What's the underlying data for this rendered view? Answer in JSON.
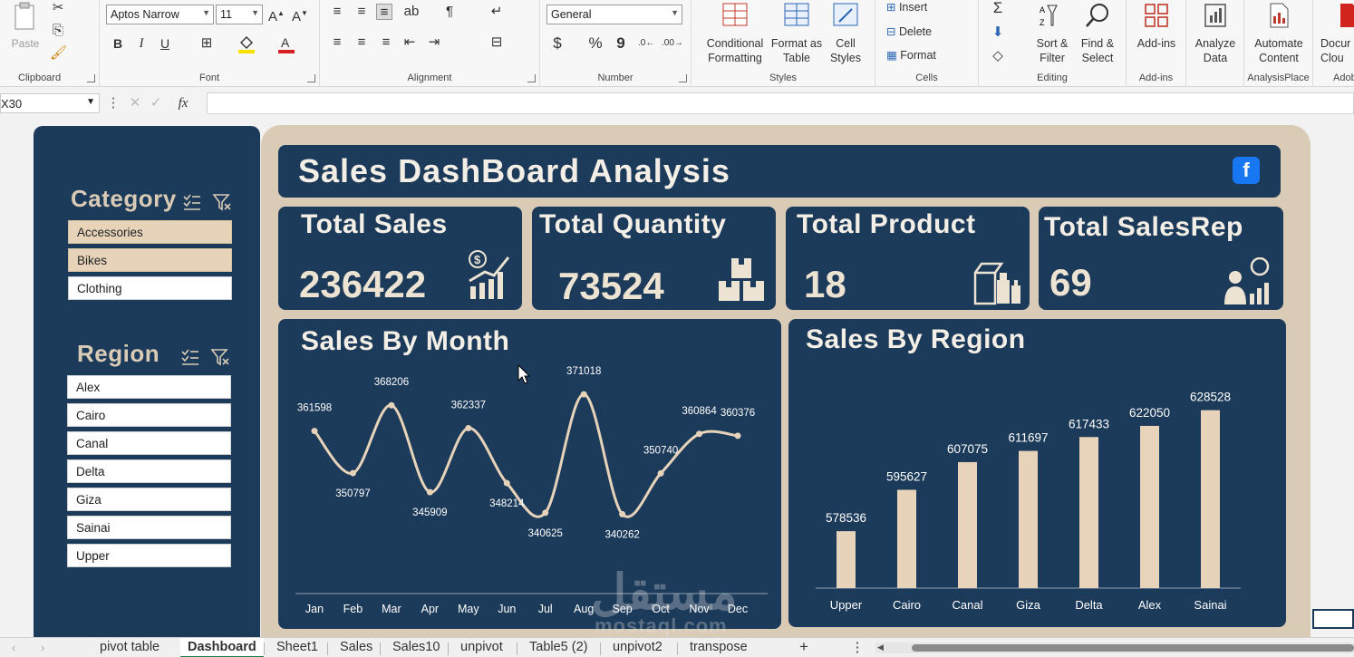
{
  "ribbon": {
    "clipboard": {
      "label": "Clipboard",
      "paste": "Paste"
    },
    "font": {
      "label": "Font",
      "name": "Aptos Narrow",
      "size": "11",
      "bold": "B",
      "italic": "I",
      "underline": "U",
      "fill_color": "#f5e000",
      "font_color": "#d42020"
    },
    "alignment": {
      "label": "Alignment"
    },
    "number": {
      "label": "Number",
      "format": "General",
      "currency": "$",
      "percent": "%",
      "comma": "9"
    },
    "styles": {
      "label": "Styles",
      "conditional": "Conditional",
      "conditional2": "Formatting",
      "format_table": "Format as",
      "format_table2": "Table",
      "cell_styles": "Cell",
      "cell_styles2": "Styles"
    },
    "cells": {
      "label": "Cells",
      "insert": "Insert",
      "delete": "Delete",
      "format": "Format"
    },
    "editing": {
      "label": "Editing",
      "sort": "Sort &",
      "sort2": "Filter",
      "find": "Find &",
      "find2": "Select"
    },
    "addins": {
      "label": "Add-ins",
      "btn": "Add-ins"
    },
    "analyze": {
      "btn": "Analyze",
      "btn2": "Data"
    },
    "analysisplace": {
      "label": "AnalysisPlace",
      "btn": "Automate",
      "btn2": "Content"
    },
    "adobe": {
      "label": "Adob",
      "btn": "Docur",
      "btn2": "Clou"
    }
  },
  "formula_bar": {
    "name_box": "X30",
    "fx": "fx",
    "content": ""
  },
  "dashboard": {
    "title": "Sales DashBoard Analysis",
    "category_slicer": {
      "title": "Category",
      "items": [
        {
          "label": "Accessories",
          "selected": true
        },
        {
          "label": "Bikes",
          "selected": true
        },
        {
          "label": "Clothing",
          "selected": false
        }
      ]
    },
    "region_slicer": {
      "title": "Region",
      "items": [
        {
          "label": "Alex"
        },
        {
          "label": "Cairo"
        },
        {
          "label": "Canal"
        },
        {
          "label": "Delta"
        },
        {
          "label": "Giza"
        },
        {
          "label": "Sainai"
        },
        {
          "label": "Upper"
        }
      ]
    },
    "kpis": [
      {
        "title": "Total Sales",
        "value": "236422",
        "icon": "chart-dollar-icon"
      },
      {
        "title": "Total Quantity",
        "value": "73524",
        "icon": "boxes-icon"
      },
      {
        "title": "Total Product",
        "value": "18",
        "icon": "products-icon"
      },
      {
        "title": "Total SalesRep",
        "value": "69",
        "icon": "salesrep-icon"
      }
    ],
    "colors": {
      "panel": "#1c3a5a",
      "accent": "#e6d3ba",
      "background": "#d9cbb5"
    }
  },
  "chart_data": [
    {
      "type": "line",
      "title": "Sales By Month",
      "categories": [
        "Jan",
        "Feb",
        "Mar",
        "Apr",
        "May",
        "Jun",
        "Jul",
        "Aug",
        "Sep",
        "Oct",
        "Nov",
        "Dec"
      ],
      "values": [
        361598,
        350797,
        368206,
        345909,
        362337,
        348214,
        340625,
        371018,
        340262,
        350740,
        360864,
        360376
      ],
      "ylim": [
        335000,
        375000
      ],
      "grid": false
    },
    {
      "type": "bar",
      "title": "Sales By Region",
      "categories": [
        "Upper",
        "Cairo",
        "Canal",
        "Giza",
        "Delta",
        "Alex",
        "Sainai"
      ],
      "values": [
        578536,
        595627,
        607075,
        611697,
        617433,
        622050,
        628528
      ],
      "ylim": [
        555000,
        640000
      ],
      "grid": false
    }
  ],
  "watermark": {
    "text": "مستقل",
    "sub": "mostaql.com"
  },
  "tabs": [
    "pivot table",
    "Dashboard",
    "Sheet1",
    "Sales",
    "Sales10",
    "unpivot",
    "Table5 (2)",
    "unpivot2",
    "transpose"
  ],
  "active_tab": "Dashboard"
}
